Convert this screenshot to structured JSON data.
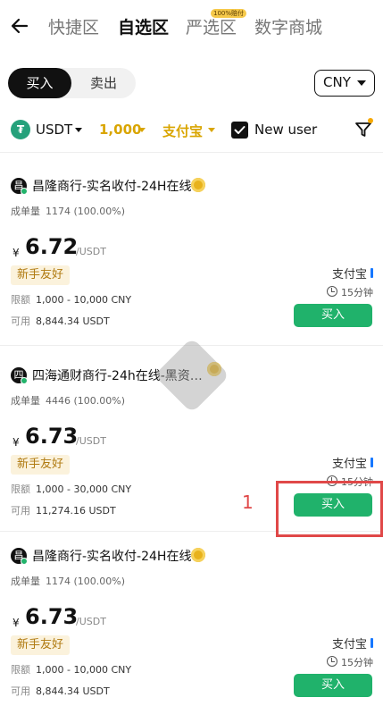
{
  "nav": {
    "tabs": [
      {
        "label": "快捷区"
      },
      {
        "label": "自选区"
      },
      {
        "label": "严选区"
      },
      {
        "label": "数字商城"
      }
    ],
    "badge": "100%赔付"
  },
  "toggle": {
    "buy": "买入",
    "sell": "卖出"
  },
  "currency": "CNY",
  "filters": {
    "coin": "USDT",
    "amount": "1,000",
    "payment": "支付宝",
    "new_user_checked": true,
    "new_user_label": "New user"
  },
  "ads": [
    {
      "avatar": "昌",
      "merchant": "昌隆商行-实名收付-24H在线",
      "orders_label": "成单量",
      "orders": "1174 (100.00%)",
      "yen": "¥",
      "price": "6.72",
      "unit": "/USDT",
      "tag": "新手友好",
      "limit_label": "限额",
      "limit": "1,000 - 10,000 CNY",
      "avail_label": "可用",
      "avail": "8,844.34 USDT",
      "payment": "支付宝",
      "time": "15分钟",
      "button": "买入"
    },
    {
      "avatar": "四",
      "merchant": "四海通财商行-24h在线-黑资…",
      "orders_label": "成单量",
      "orders": "4446 (100.00%)",
      "yen": "¥",
      "price": "6.73",
      "unit": "/USDT",
      "tag": "新手友好",
      "limit_label": "限额",
      "limit": "1,000 - 30,000 CNY",
      "avail_label": "可用",
      "avail": "11,274.16 USDT",
      "payment": "支付宝",
      "time": "15分钟",
      "button": "买入"
    },
    {
      "avatar": "昌",
      "merchant": "昌隆商行-实名收付-24H在线",
      "orders_label": "成单量",
      "orders": "1174 (100.00%)",
      "yen": "¥",
      "price": "6.73",
      "unit": "/USDT",
      "tag": "新手友好",
      "limit_label": "限额",
      "limit": "1,000 - 10,000 CNY",
      "avail_label": "可用",
      "avail": "8,844.34 USDT",
      "payment": "支付宝",
      "time": "15分钟",
      "button": "买入"
    }
  ],
  "annotation": {
    "number": "1",
    "color": "#e04848"
  },
  "colors": {
    "accent_green": "#20b26b",
    "accent_gold": "#d9a500",
    "usdt": "#26a17b"
  }
}
